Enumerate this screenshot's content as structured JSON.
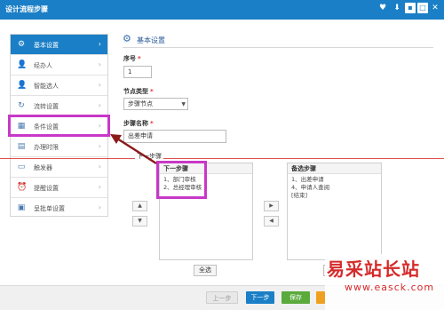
{
  "window": {
    "title": "设计流程步骤"
  },
  "titlebar_icons": [
    "heart-icon",
    "download-icon",
    "minimize-icon",
    "maximize-icon",
    "close-icon"
  ],
  "titlebar_glyphs": {
    "heart": "♥",
    "download": "⬇",
    "minimize": "▪",
    "maximize": "□",
    "close": "✕"
  },
  "sidebar": {
    "items": [
      {
        "label": "基本设置",
        "icon": "gear-icon",
        "glyph": "⚙",
        "active": true
      },
      {
        "label": "经办人",
        "icon": "user-icon",
        "glyph": "👤",
        "active": false
      },
      {
        "label": "智能选人",
        "icon": "smart-user-icon",
        "glyph": "👤",
        "active": false
      },
      {
        "label": "流转设置",
        "icon": "refresh-icon",
        "glyph": "↻",
        "active": false
      },
      {
        "label": "条件设置",
        "icon": "grid-icon",
        "glyph": "▦",
        "active": false
      },
      {
        "label": "办理时限",
        "icon": "timer-icon",
        "glyph": "▤",
        "active": false
      },
      {
        "label": "触发器",
        "icon": "window-icon",
        "glyph": "▭",
        "active": false
      },
      {
        "label": "提醒设置",
        "icon": "alarm-icon",
        "glyph": "⏰",
        "active": false
      },
      {
        "label": "呈批单设置",
        "icon": "form-icon",
        "glyph": "▣",
        "active": false
      }
    ],
    "chevron": "›"
  },
  "section": {
    "title": "基本设置",
    "icon": "gear-icon",
    "glyph": "⚙"
  },
  "form": {
    "seq_label": "序号",
    "seq_value": "1",
    "node_type_label": "节点类型",
    "node_type_value": "步骤节点",
    "step_name_label": "步骤名称",
    "step_name_value": "出差申请",
    "required_mark": "*",
    "select_arrow": "▼"
  },
  "next_step": {
    "section_label": "下一步骤",
    "list_header": "下一步骤",
    "items": [
      "1、部门审核",
      "2、总经理审核"
    ]
  },
  "alt_steps": {
    "list_header": "备选步骤",
    "items": [
      "1、出差申请",
      "4、申请人查阅",
      "[结束]"
    ]
  },
  "move_buttons": {
    "up": "▲",
    "down": "▼",
    "left": "◀",
    "right": "▶"
  },
  "select_all_label": "全选",
  "partial_button_label": "全",
  "footer": {
    "prev": "上一步",
    "next": "下一步",
    "save": "保存"
  },
  "watermark": {
    "brand": "易采站长站",
    "url": "www.easck.com"
  },
  "colors": {
    "primary": "#1a7fc6",
    "highlight": "#c838c8",
    "save": "#5aaa3c",
    "redline": "#e05050",
    "arrow": "#8b1a1a"
  }
}
